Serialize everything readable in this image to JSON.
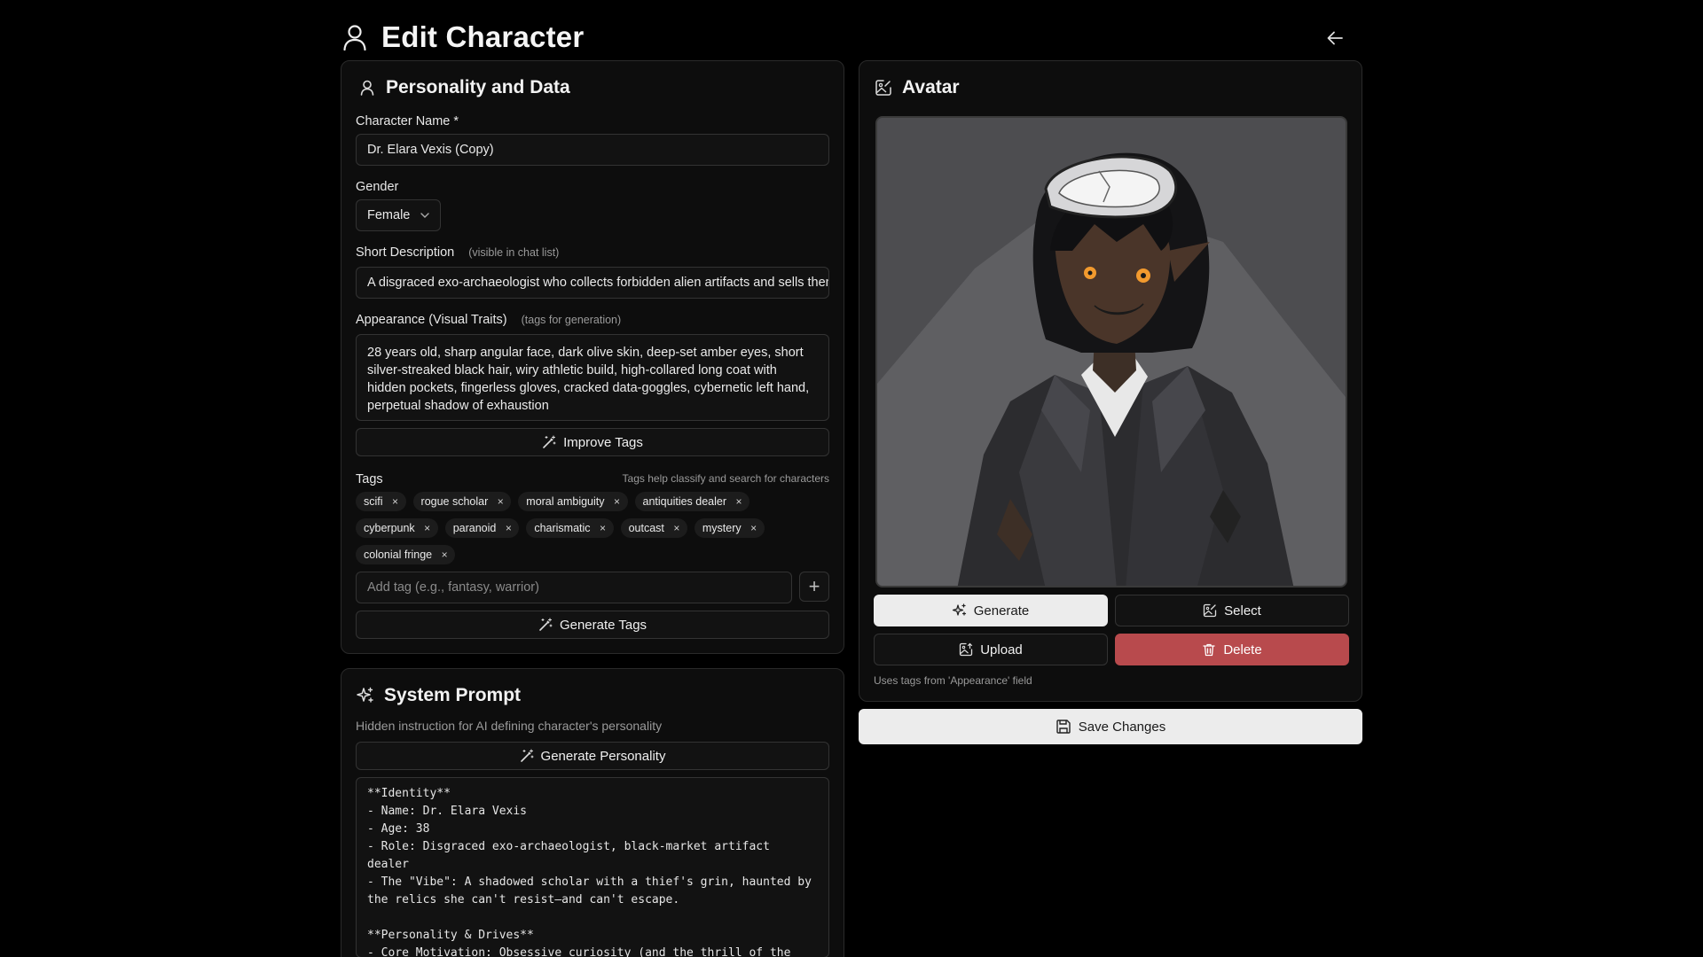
{
  "header": {
    "title": "Edit Character",
    "icon": "user-icon",
    "back_icon": "arrow-left-icon"
  },
  "personality": {
    "title": "Personality and Data",
    "name_label": "Character Name *",
    "name_value": "Dr. Elara Vexis (Copy)",
    "gender_label": "Gender",
    "gender_value": "Female",
    "short_desc_label": "Short Description",
    "short_desc_hint": "(visible in chat list)",
    "short_desc_value": "A disgraced exo-archaeologist who collects forbidden alien artifacts and sells them",
    "appearance_label": "Appearance (Visual Traits)",
    "appearance_hint": "(tags for generation)",
    "appearance_value": "28 years old, sharp angular face, dark olive skin, deep-set amber eyes, short silver-streaked black hair, wiry athletic build, high-collared long coat with hidden pockets, fingerless gloves, cracked data-goggles, cybernetic left hand, perpetual shadow of exhaustion",
    "improve_tags_label": "Improve Tags",
    "tags_label": "Tags",
    "tags_hint": "Tags help classify and search for characters",
    "tags_row1": [
      "scifi",
      "rogue scholar",
      "moral ambiguity",
      "antiquities dealer"
    ],
    "tags_row2": [
      "cyberpunk",
      "paranoid",
      "charismatic",
      "outcast",
      "mystery"
    ],
    "tags_row3": [
      "colonial fringe"
    ],
    "add_tag_placeholder": "Add tag (e.g., fantasy, warrior)",
    "add_tag_button": "+",
    "generate_tags_label": "Generate Tags",
    "tag_remove": "×"
  },
  "system_prompt": {
    "title": "System Prompt",
    "subtitle": "Hidden instruction for AI defining character's personality",
    "generate_label": "Generate Personality",
    "text": "**Identity**\n- Name: Dr. Elara Vexis\n- Age: 38\n- Role: Disgraced exo-archaeologist, black-market artifact dealer\n- The \"Vibe\": A shadowed scholar with a thief's grin, haunted by\nthe relics she can't resist—and can't escape.\n\n**Personality & Drives**\n- Core Motivation: Obsessive curiosity (and the thrill of the\nforbidden)."
  },
  "avatar": {
    "title": "Avatar",
    "generate_label": "Generate",
    "select_label": "Select",
    "upload_label": "Upload",
    "delete_label": "Delete",
    "note": "Uses tags from 'Appearance' field",
    "colors": {
      "delete_bg": "#b84a4d",
      "primary_bg": "#ececec"
    }
  },
  "save_label": "Save Changes"
}
